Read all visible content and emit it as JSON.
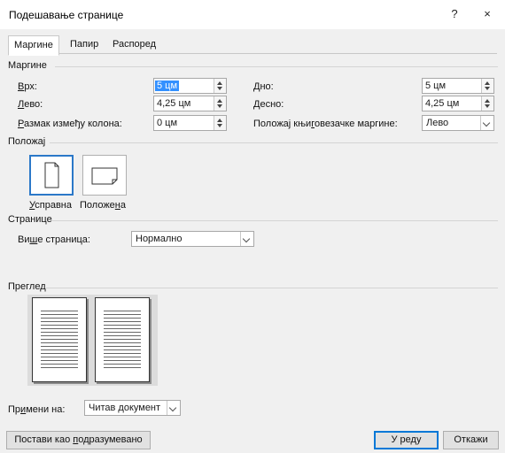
{
  "window": {
    "title": "Подешавање странице",
    "help": "?",
    "close": "×"
  },
  "tabs": [
    {
      "label": "Маргине",
      "active": true
    },
    {
      "label": "Папир",
      "active": false
    },
    {
      "label": "Распоред",
      "active": false
    }
  ],
  "margins": {
    "group_label": "Маргине",
    "top": {
      "pre": "",
      "key": "В",
      "post": "рх:",
      "value": "5 цм",
      "selected": true
    },
    "bottom": {
      "pre": "",
      "key": "Д",
      "post": "но:",
      "value": "5 цм"
    },
    "left": {
      "pre": "",
      "key": "Л",
      "post": "ево:",
      "value": "4,25 цм"
    },
    "right": {
      "pre": "",
      "key": "Д",
      "post": "есно:",
      "value": "4,25 цм"
    },
    "gutter": {
      "pre": "",
      "key": "Р",
      "post": "азмак између колона:",
      "value": "0 цм"
    },
    "gutter_pos": {
      "pre": "Положај књи",
      "key": "г",
      "post": "овезачке маргине:",
      "value": "Лево"
    }
  },
  "orientation": {
    "group_label": "Положај",
    "portrait": {
      "pre": "",
      "key": "У",
      "post": "справна",
      "selected": true
    },
    "landscape": {
      "pre": "Положе",
      "key": "н",
      "post": "а"
    }
  },
  "pages": {
    "group_label": "Странице",
    "multiple": {
      "pre": "Ви",
      "key": "ш",
      "post": "е страница:",
      "value": "Нормално"
    }
  },
  "preview": {
    "group_label": "Преглед"
  },
  "apply": {
    "pre": "Пр",
    "key": "и",
    "post": "мени на:",
    "value": "Читав документ"
  },
  "buttons": {
    "set_default": {
      "pre": "Постави као ",
      "key": "п",
      "post": "одразумевано"
    },
    "ok": "У реду",
    "cancel": "Откажи"
  },
  "colors": {
    "selection": "#3390ff",
    "accent": "#2b78c8",
    "default_button": "#0078d7"
  }
}
